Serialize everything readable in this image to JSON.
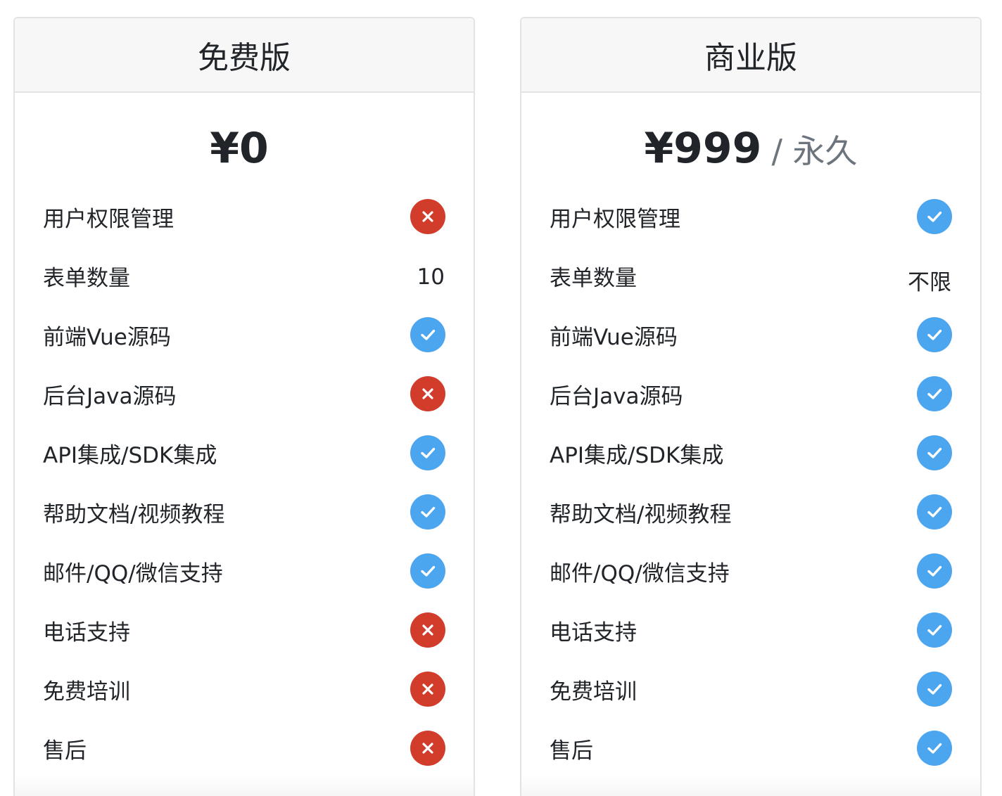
{
  "plans": [
    {
      "title": "免费版",
      "price": "¥0",
      "period": "",
      "features": [
        {
          "label": "用户权限管理",
          "type": "cross"
        },
        {
          "label": "表单数量",
          "type": "text",
          "value": "10"
        },
        {
          "label": "前端Vue源码",
          "type": "check"
        },
        {
          "label": "后台Java源码",
          "type": "cross"
        },
        {
          "label": "API集成/SDK集成",
          "type": "check"
        },
        {
          "label": "帮助文档/视频教程",
          "type": "check"
        },
        {
          "label": "邮件/QQ/微信支持",
          "type": "check"
        },
        {
          "label": "电话支持",
          "type": "cross"
        },
        {
          "label": "免费培训",
          "type": "cross"
        },
        {
          "label": "售后",
          "type": "cross"
        }
      ]
    },
    {
      "title": "商业版",
      "price": "¥999",
      "period": "/ 永久",
      "features": [
        {
          "label": "用户权限管理",
          "type": "check"
        },
        {
          "label": "表单数量",
          "type": "text",
          "value": "不限"
        },
        {
          "label": "前端Vue源码",
          "type": "check"
        },
        {
          "label": "后台Java源码",
          "type": "check"
        },
        {
          "label": "API集成/SDK集成",
          "type": "check"
        },
        {
          "label": "帮助文档/视频教程",
          "type": "check"
        },
        {
          "label": "邮件/QQ/微信支持",
          "type": "check"
        },
        {
          "label": "电话支持",
          "type": "check"
        },
        {
          "label": "免费培训",
          "type": "check"
        },
        {
          "label": "售后",
          "type": "check"
        }
      ]
    }
  ],
  "colors": {
    "check": "#4ca5ef",
    "cross": "#d23c2a",
    "header_bg": "#f7f7f7",
    "period_text": "#6c757d"
  },
  "icons": {
    "check": "check-icon",
    "cross": "cross-icon"
  }
}
